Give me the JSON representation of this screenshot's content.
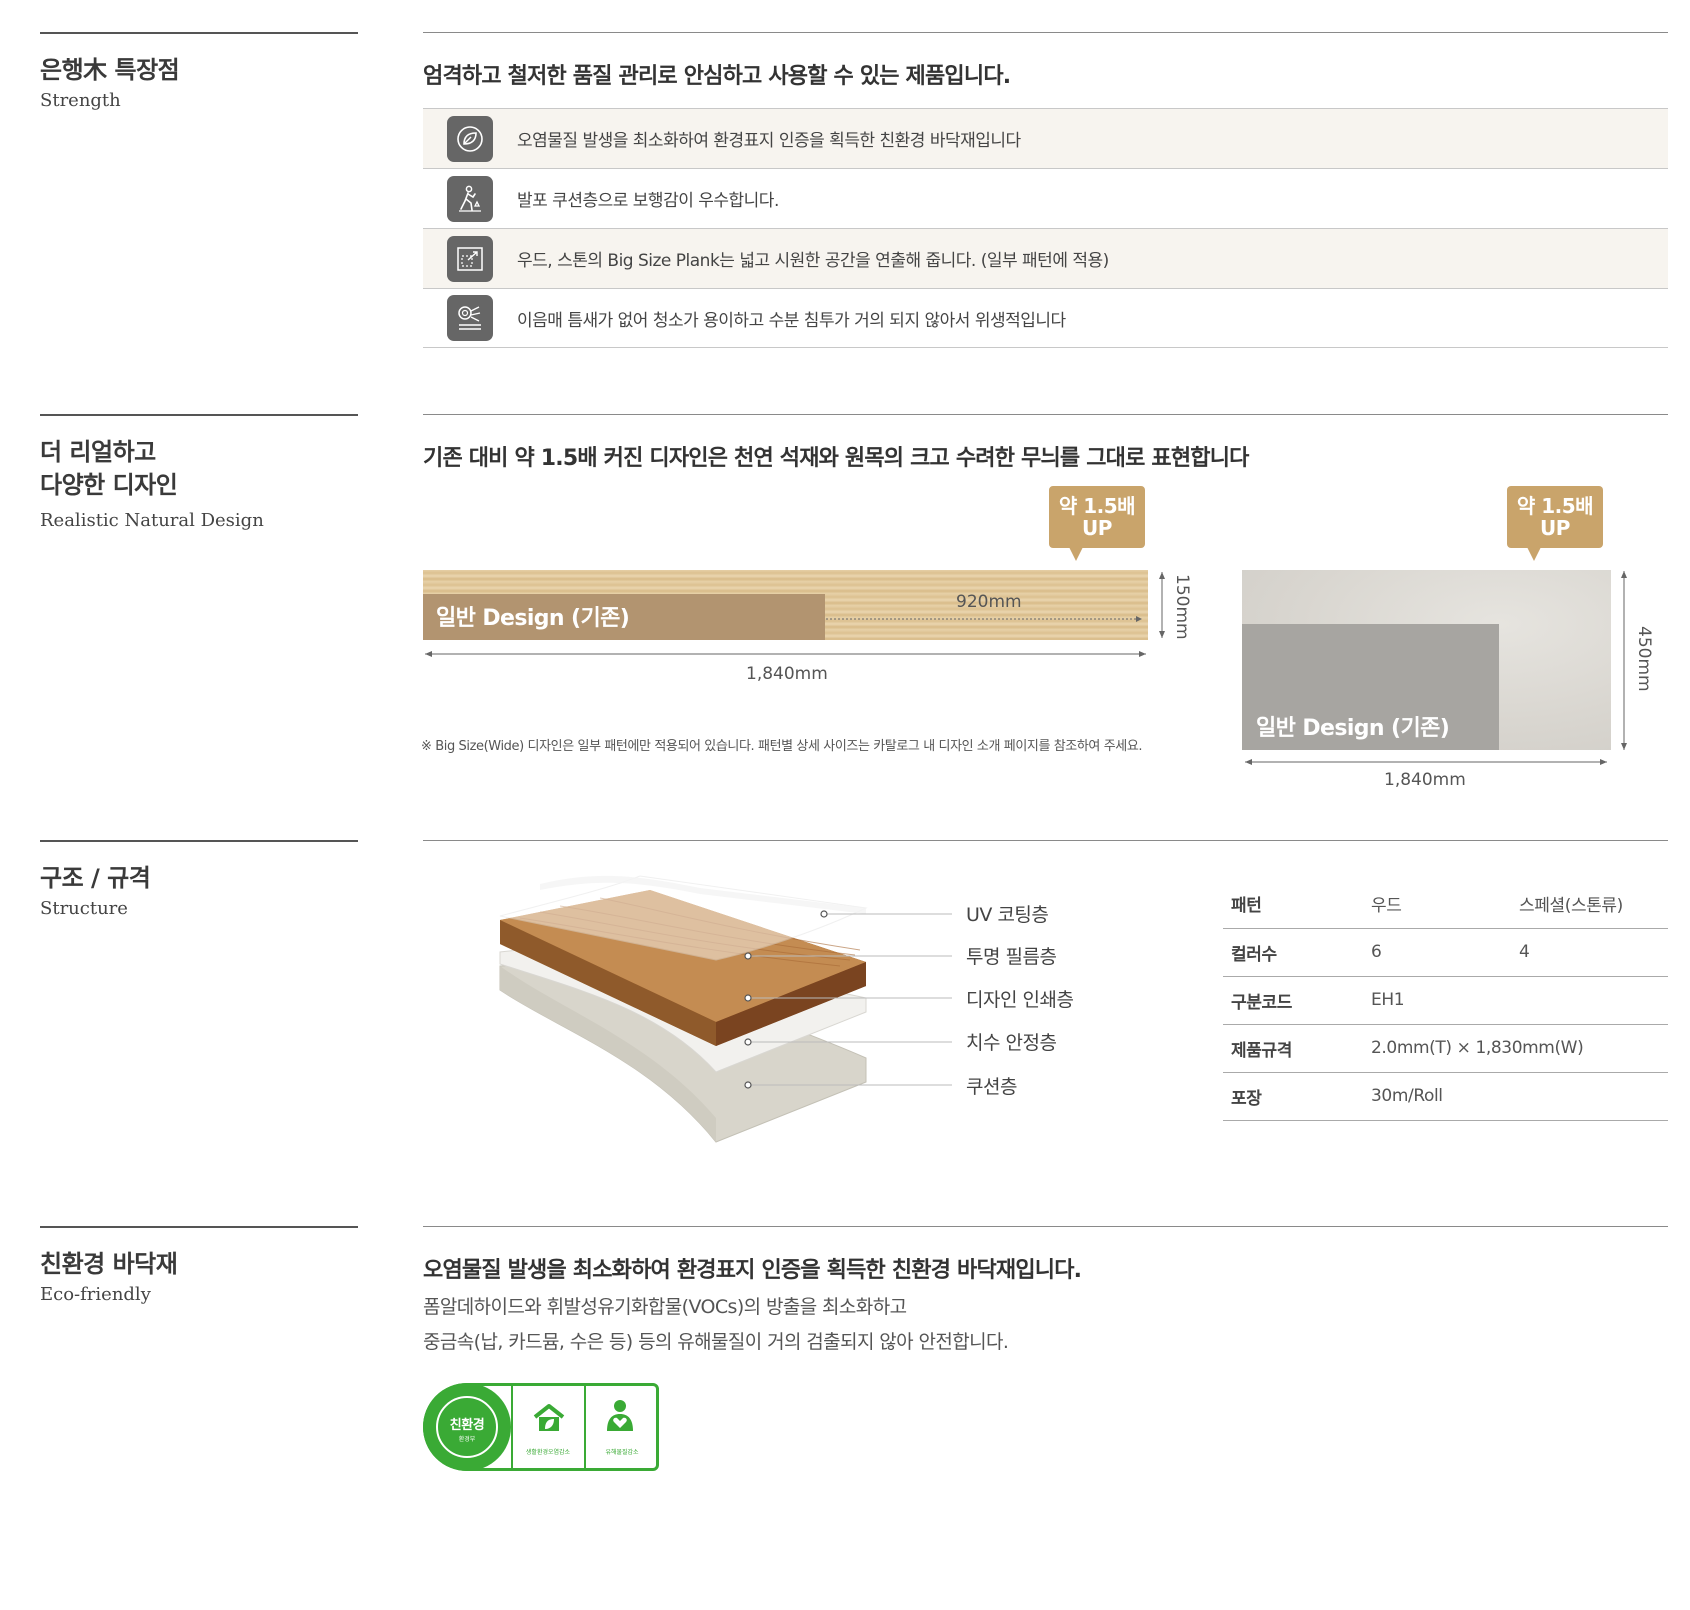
{
  "strength": {
    "title": "은행木 특장점",
    "subtitle": "Strength",
    "headline": "엄격하고 철저한 품질 관리로 안심하고 사용할 수 있는 제품입니다.",
    "items": [
      {
        "icon": "leaf-icon",
        "text": "오염물질 발생을 최소화하여 환경표지 인증을 획득한 친환경 바닥재입니다"
      },
      {
        "icon": "walking-person-icon",
        "text": "발포 쿠션층으로 보행감이 우수합니다."
      },
      {
        "icon": "expand-icon",
        "text": "우드, 스톤의 Big Size Plank는 넓고 시원한 공간을 연출해 줍니다. (일부 패턴에 적용)"
      },
      {
        "icon": "cleaning-roller-icon",
        "text": "이음매 틈새가 없어 청소가 용이하고 수분 침투가 거의 되지 않아서 위생적입니다"
      }
    ]
  },
  "design": {
    "title_line1": "더 리얼하고",
    "title_line2": "다양한 디자인",
    "subtitle": "Realistic Natural Design",
    "headline": "기존 대비 약 1.5배 커진 디자인은 천연 석재와 원목의 크고 수려한 무늬를 그대로 표현합니다",
    "badge_line1": "약 1.5배",
    "badge_line2": "UP",
    "normal_label": "일반 Design (기존)",
    "wood": {
      "length_inner": "920mm",
      "width": "150mm",
      "length": "1,840mm"
    },
    "stone": {
      "width": "450mm",
      "length": "1,840mm"
    },
    "note": "※ Big Size(Wide) 디자인은 일부 패턴에만 적용되어 있습니다. 패턴별 상세 사이즈는 카탈로그 내 디자인 소개 페이지를 참조하여 주세요."
  },
  "structure": {
    "title": "구조 / 규격",
    "subtitle": "Structure",
    "layers": [
      "UV 코팅층",
      "투명 필름층",
      "디자인 인쇄층",
      "치수 안정층",
      "쿠션층"
    ],
    "specs": [
      {
        "key": "패턴",
        "v1": "우드",
        "v2": "스페셜(스톤류)"
      },
      {
        "key": "컬러수",
        "v1": "6",
        "v2": "4"
      },
      {
        "key": "구분코드",
        "v1": "EH1",
        "v2": ""
      },
      {
        "key": "제품규격",
        "v1": "2.0mm(T) × 1,830mm(W)",
        "v2": ""
      },
      {
        "key": "포장",
        "v1": "30m/Roll",
        "v2": ""
      }
    ]
  },
  "eco": {
    "title": "친환경 바닥재",
    "subtitle": "Eco-friendly",
    "headline": "오염물질 발생을 최소화하여 환경표지 인증을 획득한 친환경 바닥재입니다.",
    "body_line1": "폼알데하이드와 휘발성유기화합물(VOCs)의 방출을 최소화하고",
    "body_line2": "중금속(납, 카드뮴, 수은 등) 등의 유해물질이 거의 검출되지 않아 안전합니다.",
    "logo": {
      "mark_text": "친환경",
      "mark_sub": "환경부",
      "label1": "생활환경오염감소",
      "label2": "유해물질감소",
      "color": "#3aaa35"
    }
  }
}
